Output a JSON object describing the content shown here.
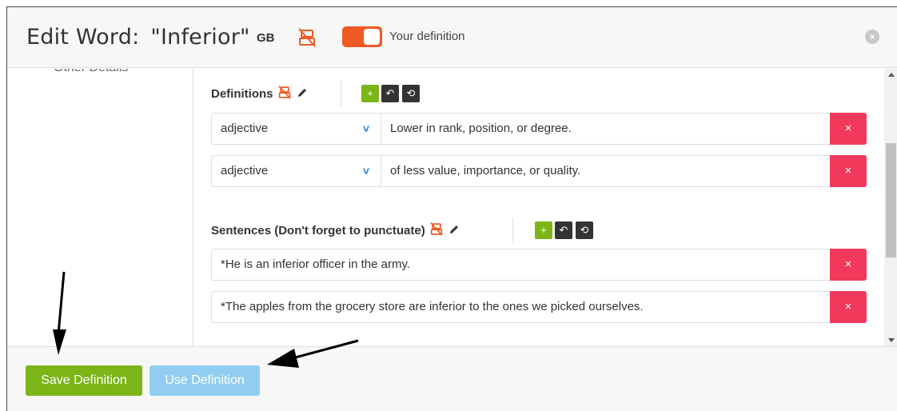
{
  "header": {
    "title_prefix": "Edit Word:",
    "word": "\"Inferior\"",
    "language": "GB",
    "toggle_label": "Your definition",
    "toggle_on": true,
    "accent_color": "#ee5a24"
  },
  "sidebar": {
    "cut_item": "Other Details"
  },
  "definitions": {
    "title": "Definitions",
    "rows": [
      {
        "part_of_speech": "adjective",
        "text": "Lower in rank, position, or degree."
      },
      {
        "part_of_speech": "adjective",
        "text": "of less value, importance, or quality."
      }
    ]
  },
  "sentences": {
    "title": "Sentences (Don't forget to punctuate)",
    "rows": [
      {
        "text": "*He is an inferior officer in the army."
      },
      {
        "text": "*The apples from the grocery store are inferior to the ones we picked ourselves."
      }
    ]
  },
  "footer": {
    "save_label": "Save Definition",
    "use_label": "Use Definition"
  },
  "icons": {
    "add": "+",
    "undo": "↶",
    "reset": "⟲",
    "delete": "×",
    "close": "×",
    "chevron": "chevron-down-icon"
  },
  "colors": {
    "green": "#7cb518",
    "dark": "#333333",
    "delete": "#f0395b",
    "use_button": "#90cdf0"
  }
}
